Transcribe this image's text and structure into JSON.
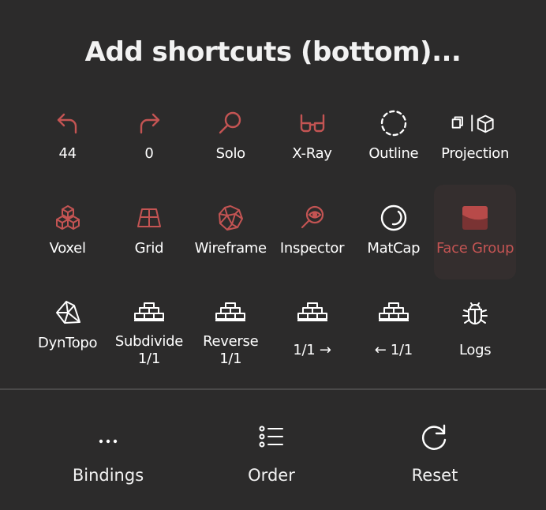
{
  "title": "Add shortcuts (bottom)...",
  "colors": {
    "active": "#c35453",
    "inactive": "#ffffff",
    "background": "#2c2b2b"
  },
  "shortcuts": [
    {
      "label": "44",
      "icon": "undo-icon",
      "active": true
    },
    {
      "label": "0",
      "icon": "redo-icon",
      "active": true
    },
    {
      "label": "Solo",
      "icon": "magnifier-icon",
      "active": true
    },
    {
      "label": "X-Ray",
      "icon": "glasses-icon",
      "active": true
    },
    {
      "label": "Outline",
      "icon": "dashed-circle-icon",
      "active": false
    },
    {
      "label": "Projection",
      "icon": "projection-icon",
      "active": false
    },
    {
      "label": "Voxel",
      "icon": "voxel-cubes-icon",
      "active": true
    },
    {
      "label": "Grid",
      "icon": "grid-plane-icon",
      "active": true
    },
    {
      "label": "Wireframe",
      "icon": "wireframe-sphere-icon",
      "active": true
    },
    {
      "label": "Inspector",
      "icon": "inspector-eye-icon",
      "active": true
    },
    {
      "label": "MatCap",
      "icon": "matcap-sphere-icon",
      "active": false
    },
    {
      "label": "Face Group",
      "icon": "face-group-icon",
      "active": true
    },
    {
      "label": "DynTopo",
      "icon": "gem-icon",
      "active": false
    },
    {
      "label": "Subdivide",
      "label2": "1/1",
      "icon": "stacked-bars-icon",
      "active": false
    },
    {
      "label": "Reverse",
      "label2": "1/1",
      "icon": "stacked-bars-icon",
      "active": false
    },
    {
      "label": "1/1 →",
      "icon": "stacked-bars-icon",
      "active": false
    },
    {
      "label": "← 1/1",
      "icon": "stacked-bars-icon",
      "active": false
    },
    {
      "label": "Logs",
      "icon": "bug-icon",
      "active": false
    }
  ],
  "bottom": {
    "bindings": {
      "label": "Bindings",
      "icon": "more-dots-icon"
    },
    "order": {
      "label": "Order",
      "icon": "list-order-icon"
    },
    "reset": {
      "label": "Reset",
      "icon": "reset-arrow-icon"
    }
  }
}
